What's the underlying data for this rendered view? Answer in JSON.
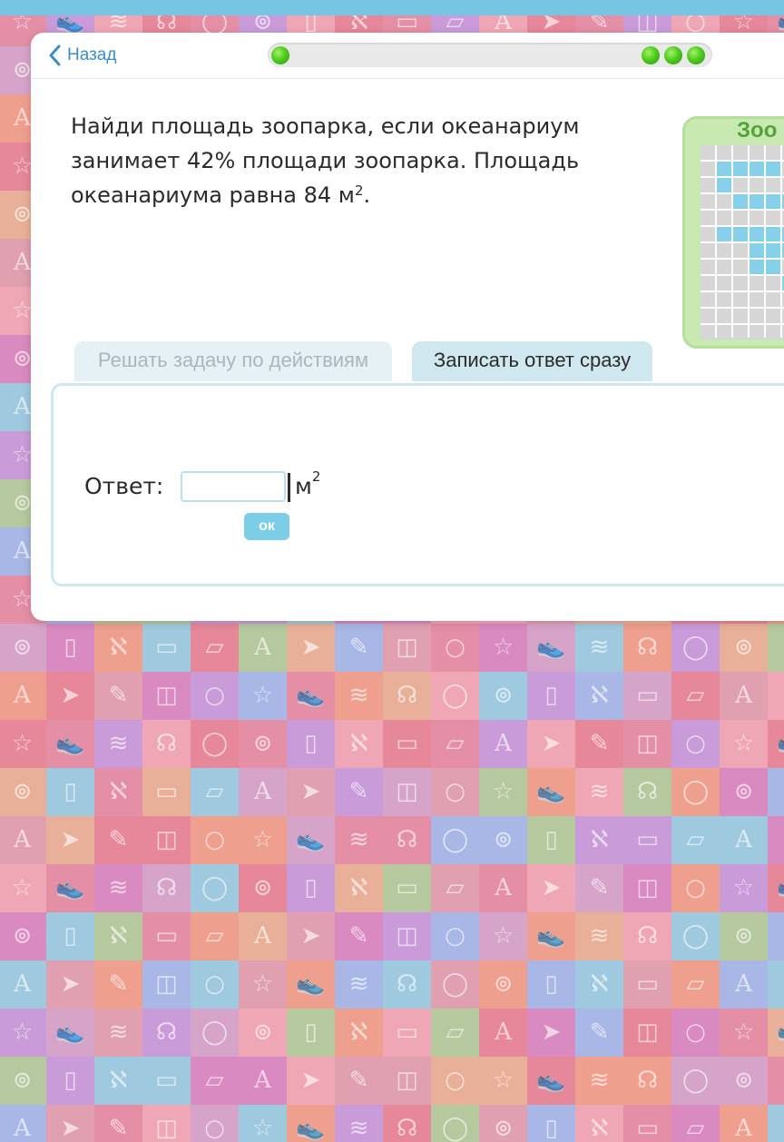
{
  "header": {
    "back_label": "Назад",
    "progress": {
      "stage": 1,
      "total_stages": 4
    }
  },
  "task": {
    "question_line1": "Найди площадь зоопарка, если океанариум",
    "question_line2": "занимает 42% площади зоопарка. Площадь",
    "question_line3_prefix": "океанариума равна 84 м",
    "question_line3_sup": "2",
    "question_line3_suffix": "."
  },
  "thumbnail": {
    "title": "Зоо"
  },
  "tabs": {
    "by_steps": "Решать задачу по действиям",
    "direct": "Записать ответ сразу"
  },
  "answer": {
    "label": "Ответ:",
    "value": "",
    "unit": "м",
    "unit_sup": "2",
    "ok_label": "ок"
  },
  "colors": {
    "accent": "#74c6e2",
    "progress_dot": "#4fcc1d",
    "ok_button": "#7ccde8",
    "tab_active": "#cfe7ef",
    "tab_inactive": "#e5f1f5",
    "zoo_frame": "#c8e9b2",
    "grid_blue": "#87d0ea"
  },
  "background_icons": [
    "star-icon",
    "sneaker-icon",
    "wifi-icon",
    "headphones-icon",
    "apple-icon",
    "globe-icon",
    "ipod-icon",
    "slingshot-icon",
    "skateboard-icon",
    "book-icon",
    "letter-a-icon",
    "paper-plane-icon",
    "pencil-icon",
    "backpack-icon",
    "circle-icon"
  ]
}
